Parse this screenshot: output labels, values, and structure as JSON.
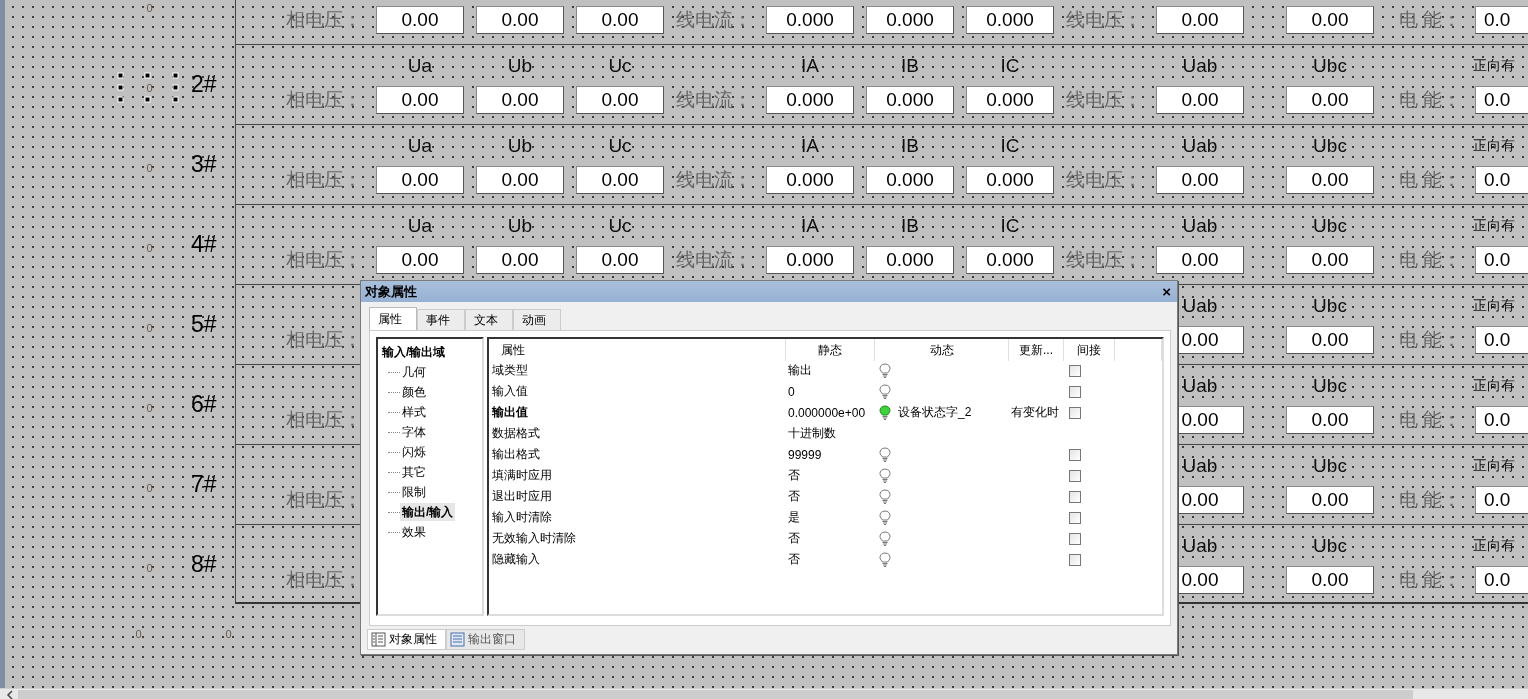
{
  "canvas": {
    "rows": [
      {
        "marker": "0",
        "selected": false,
        "fields": {
          "pv_label": "相电压：",
          "ua": "0.00",
          "ub": "0.00",
          "uc": "0.00",
          "lc_label": "线电流：",
          "ia": "0.000",
          "ib": "0.000",
          "ic": "0.000",
          "lv_label": "线电压：",
          "uab": "0.00",
          "ubc": "0.00",
          "e_label": "电 能：",
          "energy": "0.0"
        }
      },
      {
        "label": "2#",
        "marker": "0",
        "selected": true,
        "headers": {
          "ua": "Ua",
          "ub": "Ub",
          "uc": "Uc",
          "ia": "IA",
          "ib": "IB",
          "ic": "IC",
          "uab": "Uab",
          "ubc": "Ubc",
          "energy": "正向有"
        },
        "fields": {
          "pv_label": "相电压：",
          "ua": "0.00",
          "ub": "0.00",
          "uc": "0.00",
          "lc_label": "线电流：",
          "ia": "0.000",
          "ib": "0.000",
          "ic": "0.000",
          "lv_label": "线电压：",
          "uab": "0.00",
          "ubc": "0.00",
          "e_label": "电 能：",
          "energy": "0.0"
        }
      },
      {
        "label": "3#",
        "marker": "0",
        "selected": false,
        "headers": {
          "ua": "Ua",
          "ub": "Ub",
          "uc": "Uc",
          "ia": "IA",
          "ib": "IB",
          "ic": "IC",
          "uab": "Uab",
          "ubc": "Ubc",
          "energy": "正向有"
        },
        "fields": {
          "pv_label": "相电压：",
          "ua": "0.00",
          "ub": "0.00",
          "uc": "0.00",
          "lc_label": "线电流：",
          "ia": "0.000",
          "ib": "0.000",
          "ic": "0.000",
          "lv_label": "线电压：",
          "uab": "0.00",
          "ubc": "0.00",
          "e_label": "电 能：",
          "energy": "0.0"
        }
      },
      {
        "label": "4#",
        "marker": "0",
        "selected": false,
        "headers": {
          "ua": "Ua",
          "ub": "Ub",
          "uc": "Uc",
          "ia": "IA",
          "ib": "IB",
          "ic": "IC",
          "uab": "Uab",
          "ubc": "Ubc",
          "energy": "正向有"
        },
        "fields": {
          "pv_label": "相电压：",
          "ua": "0.00",
          "ub": "0.00",
          "uc": "0.00",
          "lc_label": "线电流：",
          "ia": "0.000",
          "ib": "0.000",
          "ic": "0.000",
          "lv_label": "线电压：",
          "uab": "0.00",
          "ubc": "0.00",
          "e_label": "电 能：",
          "energy": "0.0"
        }
      },
      {
        "label": "5#",
        "marker": "0",
        "selected": false,
        "headers": {
          "uab": "Uab",
          "ubc": "Ubc",
          "energy": "正向有"
        },
        "fields": {
          "pv_label": "相电压：",
          "uab": "0.00",
          "ubc": "0.00",
          "e_label": "电 能：",
          "energy": "0.0"
        }
      },
      {
        "label": "6#",
        "marker": "0",
        "selected": false,
        "headers": {
          "uab": "Uab",
          "ubc": "Ubc",
          "energy": "正向有"
        },
        "fields": {
          "pv_label": "相电压：",
          "uab": "0.00",
          "ubc": "0.00",
          "e_label": "电 能：",
          "energy": "0.0"
        }
      },
      {
        "label": "7#",
        "marker": "0",
        "selected": false,
        "headers": {
          "uab": "Uab",
          "ubc": "Ubc",
          "energy": "正向有"
        },
        "fields": {
          "pv_label": "相电压：",
          "uab": "0.00",
          "ubc": "0.00",
          "e_label": "电 能：",
          "energy": "0.0"
        }
      },
      {
        "label": "8#",
        "marker": "0",
        "selected": false,
        "headers": {
          "uab": "Uab",
          "ubc": "Ubc",
          "energy": "正向有"
        },
        "fields": {
          "pv_label": "相电压：",
          "uab": "0.00",
          "ubc": "0.00",
          "e_label": "电 能：",
          "energy": "0.0"
        }
      }
    ],
    "footer_markers": [
      "0",
      "0"
    ]
  },
  "dialog": {
    "title": "对象属性",
    "close": "×",
    "tabs": [
      {
        "label": "属性",
        "selected": true
      },
      {
        "label": "事件",
        "selected": false
      },
      {
        "label": "文本",
        "selected": false
      },
      {
        "label": "动画",
        "selected": false
      }
    ],
    "tree": {
      "label": "输入/输出域",
      "children": [
        {
          "label": "几何",
          "selected": false
        },
        {
          "label": "颜色",
          "selected": false
        },
        {
          "label": "样式",
          "selected": false
        },
        {
          "label": "字体",
          "selected": false
        },
        {
          "label": "闪烁",
          "selected": false
        },
        {
          "label": "其它",
          "selected": false
        },
        {
          "label": "限制",
          "selected": false
        },
        {
          "label": "输出/输入",
          "selected": true
        },
        {
          "label": "效果",
          "selected": false
        }
      ]
    },
    "table": {
      "columns": [
        "属性",
        "静态",
        "动态",
        "更新...",
        "间接"
      ],
      "rows": [
        {
          "property": "域类型",
          "emphasized": false,
          "static": "输出",
          "dynamic_active": false,
          "indirect_checked": false
        },
        {
          "property": "输入值",
          "emphasized": false,
          "static": "0",
          "dynamic_active": false,
          "indirect_checked": false
        },
        {
          "property": "输出值",
          "emphasized": true,
          "static": "0.000000e+00",
          "dynamic_active": true,
          "dynamic": "设备状态字_2",
          "update": "有变化时",
          "indirect_checked": false
        },
        {
          "property": "数据格式",
          "emphasized": false,
          "static": "十进制数"
        },
        {
          "property": "输出格式",
          "emphasized": false,
          "static": "99999",
          "dynamic_active": false,
          "indirect_checked": false
        },
        {
          "property": "填满时应用",
          "emphasized": false,
          "static": "否",
          "dynamic_active": false,
          "indirect_checked": false
        },
        {
          "property": "退出时应用",
          "emphasized": false,
          "static": "否",
          "dynamic_active": false,
          "indirect_checked": false
        },
        {
          "property": "输入时清除",
          "emphasized": false,
          "static": "是",
          "dynamic_active": false,
          "indirect_checked": false
        },
        {
          "property": "无效输入时清除",
          "emphasized": false,
          "static": "否",
          "dynamic_active": false,
          "indirect_checked": false
        },
        {
          "property": "隐藏输入",
          "emphasized": false,
          "static": "否",
          "dynamic_active": false,
          "indirect_checked": false
        }
      ]
    },
    "bottom_tabs": [
      {
        "label": "对象属性",
        "selected": true
      },
      {
        "label": "输出窗口",
        "selected": false
      }
    ]
  }
}
